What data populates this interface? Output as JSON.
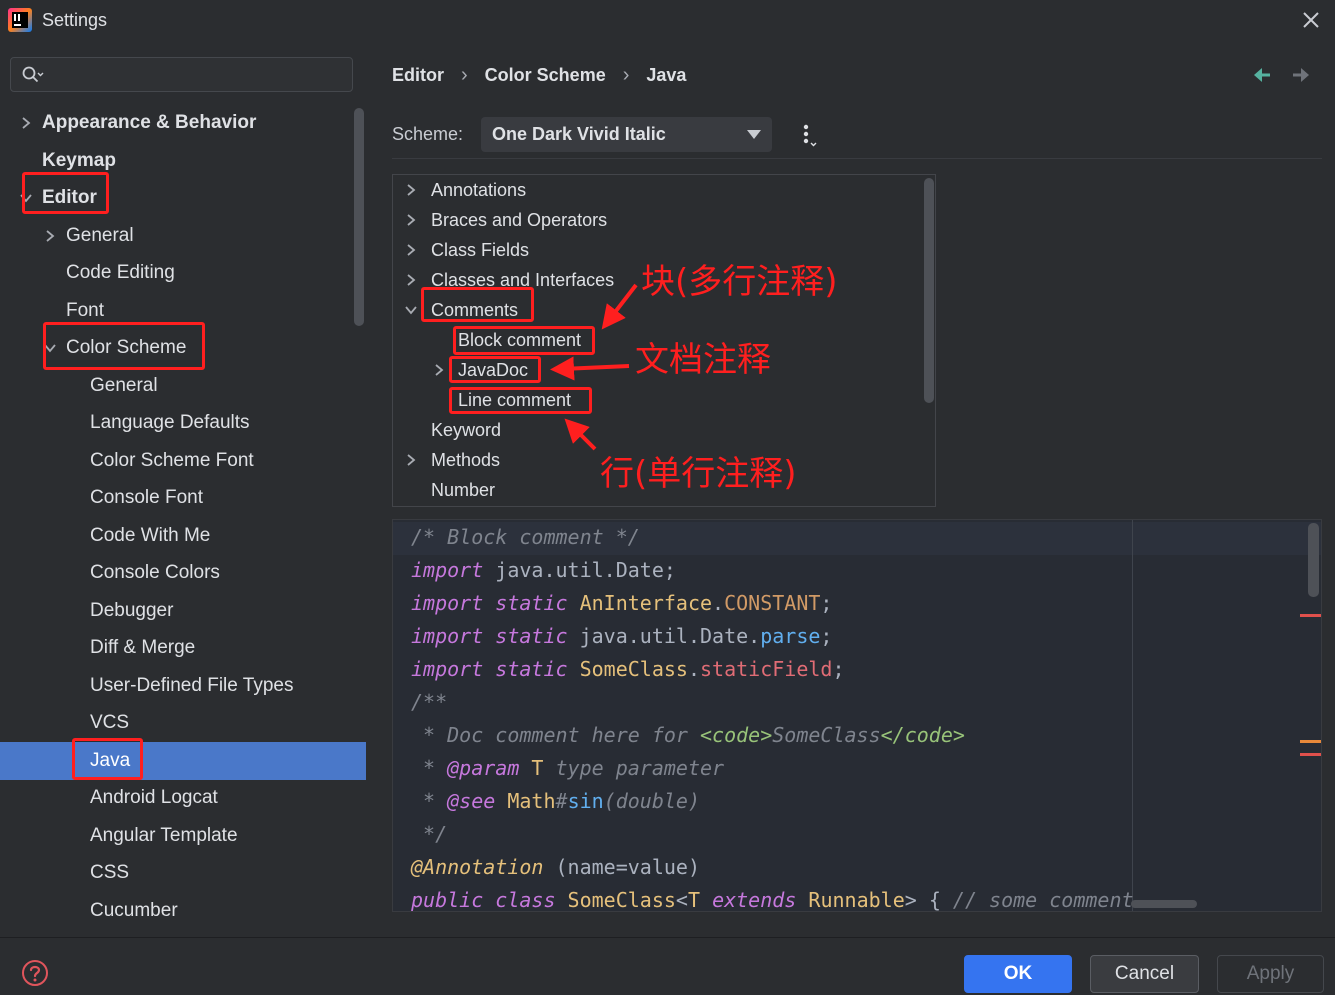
{
  "window": {
    "title": "Settings"
  },
  "sidebar": {
    "items": [
      {
        "label": "Appearance & Behavior",
        "expanded": false
      },
      {
        "label": "Keymap"
      },
      {
        "label": "Editor",
        "expanded": true
      },
      {
        "label": "General",
        "expanded": false
      },
      {
        "label": "Code Editing"
      },
      {
        "label": "Font"
      },
      {
        "label": "Color Scheme",
        "expanded": true
      },
      {
        "label": "General"
      },
      {
        "label": "Language Defaults"
      },
      {
        "label": "Color Scheme Font"
      },
      {
        "label": "Console Font"
      },
      {
        "label": "Code With Me"
      },
      {
        "label": "Console Colors"
      },
      {
        "label": "Debugger"
      },
      {
        "label": "Diff & Merge"
      },
      {
        "label": "User-Defined File Types"
      },
      {
        "label": "VCS"
      },
      {
        "label": "Java",
        "selected": true
      },
      {
        "label": "Android Logcat"
      },
      {
        "label": "Angular Template"
      },
      {
        "label": "CSS"
      },
      {
        "label": "Cucumber"
      }
    ]
  },
  "breadcrumb": {
    "items": [
      "Editor",
      "Color Scheme",
      "Java"
    ],
    "separator": "›"
  },
  "scheme": {
    "label": "Scheme:",
    "value": "One Dark Vivid Italic"
  },
  "categories": {
    "items": [
      {
        "label": "Annotations",
        "expanded": false
      },
      {
        "label": "Braces and Operators",
        "expanded": false
      },
      {
        "label": "Class Fields",
        "expanded": false
      },
      {
        "label": "Classes and Interfaces",
        "expanded": false
      },
      {
        "label": "Comments",
        "expanded": true
      },
      {
        "label": "Block comment"
      },
      {
        "label": "JavaDoc",
        "expanded": false
      },
      {
        "label": "Line comment"
      },
      {
        "label": "Keyword"
      },
      {
        "label": "Methods",
        "expanded": false
      },
      {
        "label": "Number"
      }
    ]
  },
  "annotations": {
    "block": "块(多行注释)",
    "javadoc": "文档注释",
    "line": "行(单行注释)"
  },
  "preview": {
    "lines": [
      {
        "tokens": [
          {
            "comment": "/* Block comment */"
          }
        ]
      },
      {
        "tokens": [
          {
            "keyword": "import"
          },
          {
            "plain": " java.util.Date;"
          }
        ]
      },
      {
        "tokens": [
          {
            "keyword": "import static"
          },
          {
            "plain": " "
          },
          {
            "class": "AnInterface"
          },
          {
            "plain": "."
          },
          {
            "constant": "CONSTANT"
          },
          {
            "plain": ";"
          }
        ]
      },
      {
        "tokens": [
          {
            "keyword": "import static"
          },
          {
            "plain": " java.util.Date."
          },
          {
            "method": "parse"
          },
          {
            "plain": ";"
          }
        ]
      },
      {
        "tokens": [
          {
            "keyword": "import static"
          },
          {
            "plain": " "
          },
          {
            "class": "SomeClass"
          },
          {
            "plain": "."
          },
          {
            "field": "staticField"
          },
          {
            "plain": ";"
          }
        ]
      },
      {
        "tokens": [
          {
            "comment": "/**"
          }
        ]
      },
      {
        "tokens": [
          {
            "comment": " * Doc comment here for "
          },
          {
            "tag": "<code>"
          },
          {
            "comment": "SomeClass"
          },
          {
            "tag": "</code>"
          }
        ]
      },
      {
        "tokens": [
          {
            "comment": " * "
          },
          {
            "doctag": "@param"
          },
          {
            "plain": " "
          },
          {
            "class": "T"
          },
          {
            "comment": " type parameter"
          }
        ]
      },
      {
        "tokens": [
          {
            "comment": " * "
          },
          {
            "doctag": "@see"
          },
          {
            "plain": " "
          },
          {
            "class": "Math"
          },
          {
            "comment": "#"
          },
          {
            "method": "sin"
          },
          {
            "comment": "(double)"
          }
        ]
      },
      {
        "tokens": [
          {
            "comment": " */"
          }
        ]
      },
      {
        "tokens": [
          {
            "annotation": "@Annotation"
          },
          {
            "plain": " (name=value)"
          }
        ]
      },
      {
        "tokens": [
          {
            "keyword": "public class"
          },
          {
            "plain": " "
          },
          {
            "class": "SomeClass"
          },
          {
            "plain": "<"
          },
          {
            "class": "T"
          },
          {
            "plain": " "
          },
          {
            "keyword": "extends"
          },
          {
            "plain": " "
          },
          {
            "class": "Runnable"
          },
          {
            "plain": "> { "
          },
          {
            "comment": "// some comment"
          }
        ]
      }
    ]
  },
  "footer": {
    "ok": "OK",
    "cancel": "Cancel",
    "apply": "Apply"
  },
  "icons": {
    "logo": "intellij-logo-icon",
    "close": "close-icon",
    "search": "search-icon",
    "back": "arrow-left-icon",
    "forward": "arrow-right-icon",
    "more": "kebab-menu-icon",
    "help": "help-icon"
  },
  "theme": {
    "bg": "#2b2d30",
    "text": "#dfe1e5",
    "selection": "#4a78c9",
    "accent": "#3574f0",
    "annotation": "#ff1f1f",
    "preview_bg": "#282c34",
    "current_line": "#2c313c",
    "c_plain": "#abb2bf",
    "c_keyword": "#c678dd",
    "c_class": "#e5c07b",
    "c_constant": "#d19a66",
    "c_method": "#61afef",
    "c_field": "#e06c75",
    "c_comment": "#7f848e",
    "c_tag": "#98c379"
  }
}
